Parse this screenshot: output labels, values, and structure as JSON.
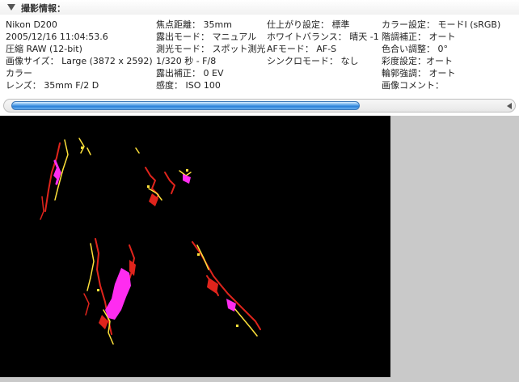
{
  "panel": {
    "title": "撮影情報："
  },
  "info": {
    "col1": [
      "Nikon D200",
      "2005/12/16 11:04:53.6",
      "圧縮 RAW (12-bit)",
      "画像サイズ： Large (3872 x 2592)",
      "カラー",
      "レンズ： 35mm F/2 D"
    ],
    "col2": [
      "焦点距離： 35mm",
      "露出モード： マニュアル",
      "測光モード： スポット測光",
      "1/320 秒 - F/8",
      "露出補正： 0 EV",
      "感度： ISO 100"
    ],
    "col3": [
      "仕上がり設定： 標準",
      "ホワイトバランス： 晴天 -1",
      "AFモード： AF-S",
      "シンクロモード： なし"
    ],
    "col4": [
      "カラー設定： モードI (sRGB)",
      "階調補正： オート",
      "色合い調整： 0°",
      "彩度設定：オート",
      "輪郭強調： オート",
      "画像コメント："
    ]
  },
  "scrollbar": {
    "position": 0.7
  },
  "colors": {
    "highlight_magenta": "#ff2cf0",
    "highlight_red": "#e0241c",
    "highlight_yellow": "#ffe23a",
    "background": "#000000",
    "canvas_gray": "#c9c9c9"
  }
}
